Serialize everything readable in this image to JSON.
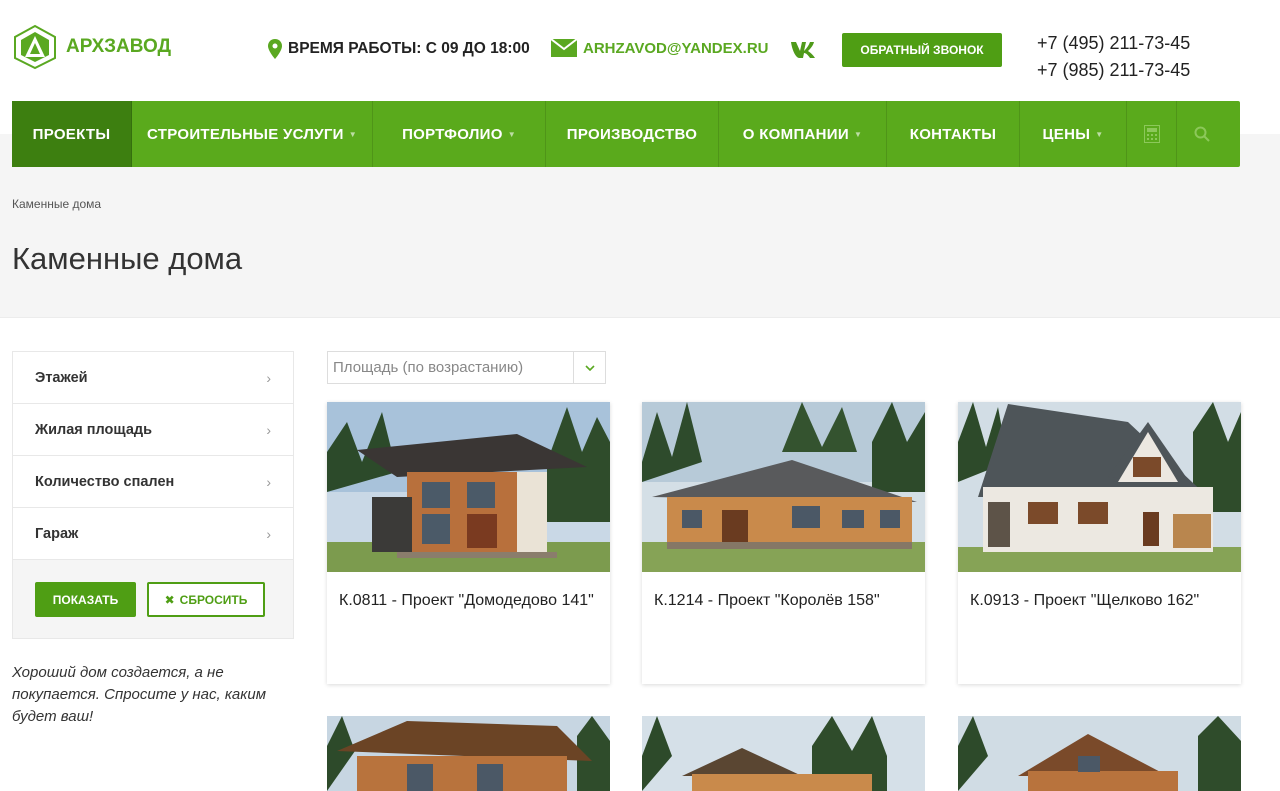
{
  "header": {
    "logo_text": "АРХЗАВОД",
    "hours": "ВРЕМЯ РАБОТЫ: С 09 ДО 18:00",
    "email": "ARHZAVOD@YANDEX.RU",
    "vk": "VK",
    "callback_label": "ОБРАТНЫЙ ЗВОНОК",
    "phone1": "+7 (495) 211-73-45",
    "phone2": "+7 (985) 211-73-45"
  },
  "nav": {
    "items": [
      {
        "label": "ПРОЕКТЫ",
        "active": true,
        "has_submenu": false
      },
      {
        "label": "СТРОИТЕЛЬНЫЕ УСЛУГИ",
        "has_submenu": true
      },
      {
        "label": "ПОРТФОЛИО",
        "has_submenu": true
      },
      {
        "label": "ПРОИЗВОДСТВО",
        "has_submenu": false
      },
      {
        "label": "О КОМПАНИИ",
        "has_submenu": true
      },
      {
        "label": "КОНТАКТЫ",
        "has_submenu": false
      },
      {
        "label": "ЦЕНЫ",
        "has_submenu": true
      }
    ],
    "icons": [
      "calculator-icon",
      "search-icon"
    ]
  },
  "breadcrumb": "Каменные дома",
  "page_title": "Каменные дома",
  "filters": {
    "items": [
      "Этажей",
      "Жилая площадь",
      "Количество спален",
      "Гараж"
    ],
    "show_label": "ПОКАЗАТЬ",
    "reset_label": "СБРОСИТЬ"
  },
  "quote": "Хороший дом создается, а не покупается. Спросите у нас, каким будет ваш!",
  "sort": {
    "selected": "Площадь (по возрастанию)"
  },
  "products": [
    {
      "title": "К.0811 - Проект \"Домодедово 141\""
    },
    {
      "title": "К.1214 - Проект \"Королёв 158\""
    },
    {
      "title": "К.0913 - Проект \"Щелково 162\""
    }
  ],
  "colors": {
    "brand": "#5aaa1c",
    "brand_dark": "#3d7f10",
    "button": "#4f9e14"
  }
}
